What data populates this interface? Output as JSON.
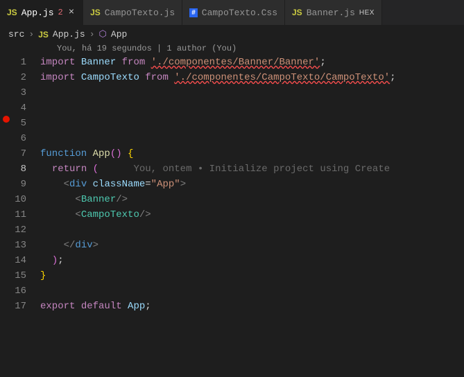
{
  "tabs": [
    {
      "icon": "JS",
      "label": "App.js",
      "badge": "2",
      "active": true,
      "close": "×"
    },
    {
      "icon": "JS",
      "label": "CampoTexto.js",
      "active": false
    },
    {
      "icon": "CSS",
      "label": "CampoTexto.Css",
      "active": false
    },
    {
      "icon": "JS",
      "label": "Banner.js",
      "hex": "HEX",
      "active": false
    }
  ],
  "breadcrumb": {
    "folder": "src",
    "fileIcon": "JS",
    "file": "App.js",
    "symbol": "App"
  },
  "codelens": "You, há 19 segundos | 1 author (You)",
  "ghost": "You, ontem • Initialize project using Create",
  "code": {
    "l1": {
      "imp": "import",
      "name": "Banner",
      "from": "from",
      "path": "'./componentes/Banner/Banner'",
      "semi": ";"
    },
    "l2": {
      "imp": "import",
      "name": "CampoTexto",
      "from": "from",
      "path": "'./componentes/CampoTexto/CampoTexto'",
      "semi": ";"
    },
    "l7": {
      "kw": "function",
      "name": "App",
      "paren": "()",
      "brace": " {"
    },
    "l8": {
      "ret": "return",
      "paren": " ("
    },
    "l9": {
      "open": "<",
      "tag": "div",
      "attr": "className",
      "eq": "=",
      "val": "\"App\"",
      "close": ">"
    },
    "l10": {
      "open": "<",
      "tag": "Banner",
      "close": "/>"
    },
    "l11": {
      "open": "<",
      "tag": "CampoTexto",
      "close": "/>"
    },
    "l13": {
      "open": "</",
      "tag": "div",
      "close": ">"
    },
    "l14": {
      "paren": ")",
      "semi": ";"
    },
    "l15": {
      "brace": "}"
    },
    "l17": {
      "exp": "export",
      "def": "default",
      "name": "App",
      "semi": ";"
    }
  },
  "linenos": [
    "1",
    "2",
    "3",
    "4",
    "5",
    "6",
    "7",
    "8",
    "9",
    "10",
    "11",
    "12",
    "13",
    "14",
    "15",
    "16",
    "17"
  ]
}
